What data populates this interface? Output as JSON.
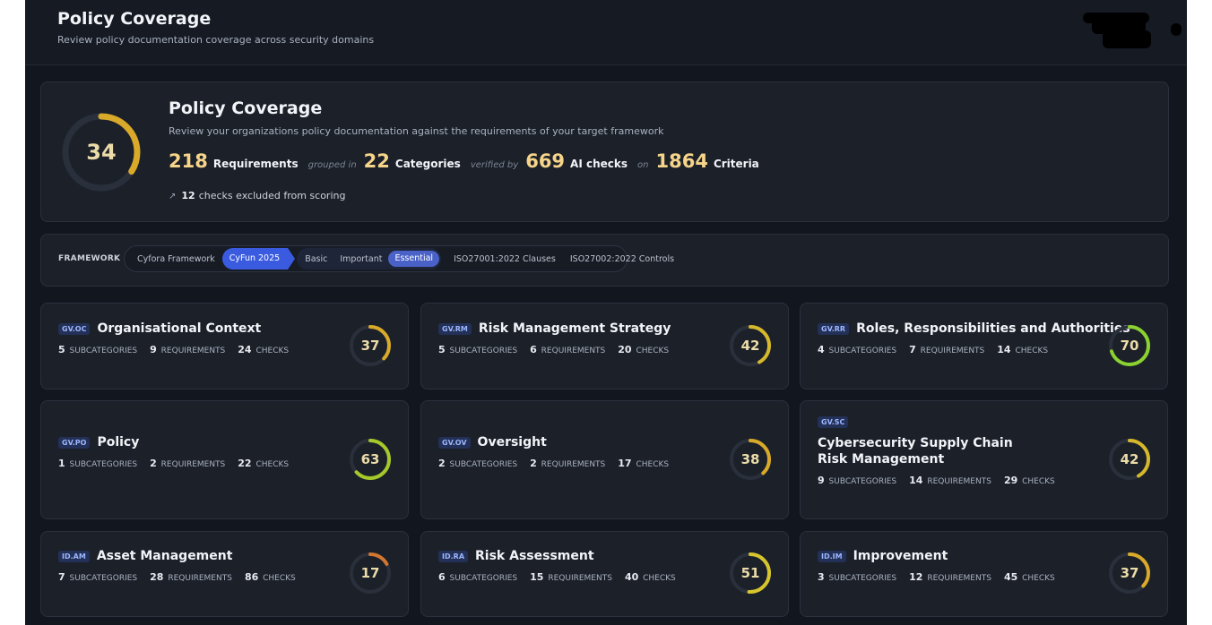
{
  "header": {
    "title": "Policy Coverage",
    "subtitle": "Review policy documentation coverage across security domains"
  },
  "overview": {
    "score": 34,
    "title": "Policy Coverage",
    "description": "Review your organizations policy documentation against the requirements of your target framework",
    "requirements": "218",
    "requirements_label": "Requirements",
    "grouped_in": "grouped in",
    "categories": "22",
    "categories_label": "Categories",
    "verified_by": "verified by",
    "ai_checks": "669",
    "ai_checks_label": "AI checks",
    "on": "on",
    "criteria": "1864",
    "criteria_label": "Criteria",
    "excluded_count": "12",
    "excluded_label": "checks excluded from scoring",
    "excluded_icon": "arrow-up-right-icon"
  },
  "framework": {
    "label": "FRAMEWORK",
    "options": [
      "Cyfora Framework",
      "CyFun 2025",
      "ISO27001:2022 Clauses",
      "ISO27002:2022 Controls"
    ],
    "active": "CyFun 2025",
    "levels": [
      "Basic",
      "Important",
      "Essential"
    ],
    "selected_level": "Essential"
  },
  "labels": {
    "subcategories": "SUBCATEGORIES",
    "requirements": "REQUIREMENTS",
    "checks": "CHECKS"
  },
  "colors": {
    "accent_blue": "#3a5be0",
    "score_gold": "#d9a92a",
    "score_green": "#a6c82a",
    "score_bright_green": "#8bd12f",
    "score_orange": "#d2762f",
    "score_yellow": "#d6c52c"
  },
  "domains": [
    {
      "code": "GV.OC",
      "name": "Organisational Context",
      "subcategories": "5",
      "requirements": "9",
      "checks": "24",
      "score": 37
    },
    {
      "code": "GV.RM",
      "name": "Risk Management Strategy",
      "subcategories": "5",
      "requirements": "6",
      "checks": "20",
      "score": 42
    },
    {
      "code": "GV.RR",
      "name": "Roles, Responsibilities and Authorities",
      "subcategories": "4",
      "requirements": "7",
      "checks": "14",
      "score": 70
    },
    {
      "code": "GV.PO",
      "name": "Policy",
      "subcategories": "1",
      "requirements": "2",
      "checks": "22",
      "score": 63
    },
    {
      "code": "GV.OV",
      "name": "Oversight",
      "subcategories": "2",
      "requirements": "2",
      "checks": "17",
      "score": 38
    },
    {
      "code": "GV.SC",
      "name": "Cybersecurity Supply Chain Risk Management",
      "subcategories": "9",
      "requirements": "14",
      "checks": "29",
      "score": 42
    },
    {
      "code": "ID.AM",
      "name": "Asset Management",
      "subcategories": "7",
      "requirements": "28",
      "checks": "86",
      "score": 17
    },
    {
      "code": "ID.RA",
      "name": "Risk Assessment",
      "subcategories": "6",
      "requirements": "15",
      "checks": "40",
      "score": 51
    },
    {
      "code": "ID.IM",
      "name": "Improvement",
      "subcategories": "3",
      "requirements": "12",
      "checks": "45",
      "score": 37
    }
  ]
}
